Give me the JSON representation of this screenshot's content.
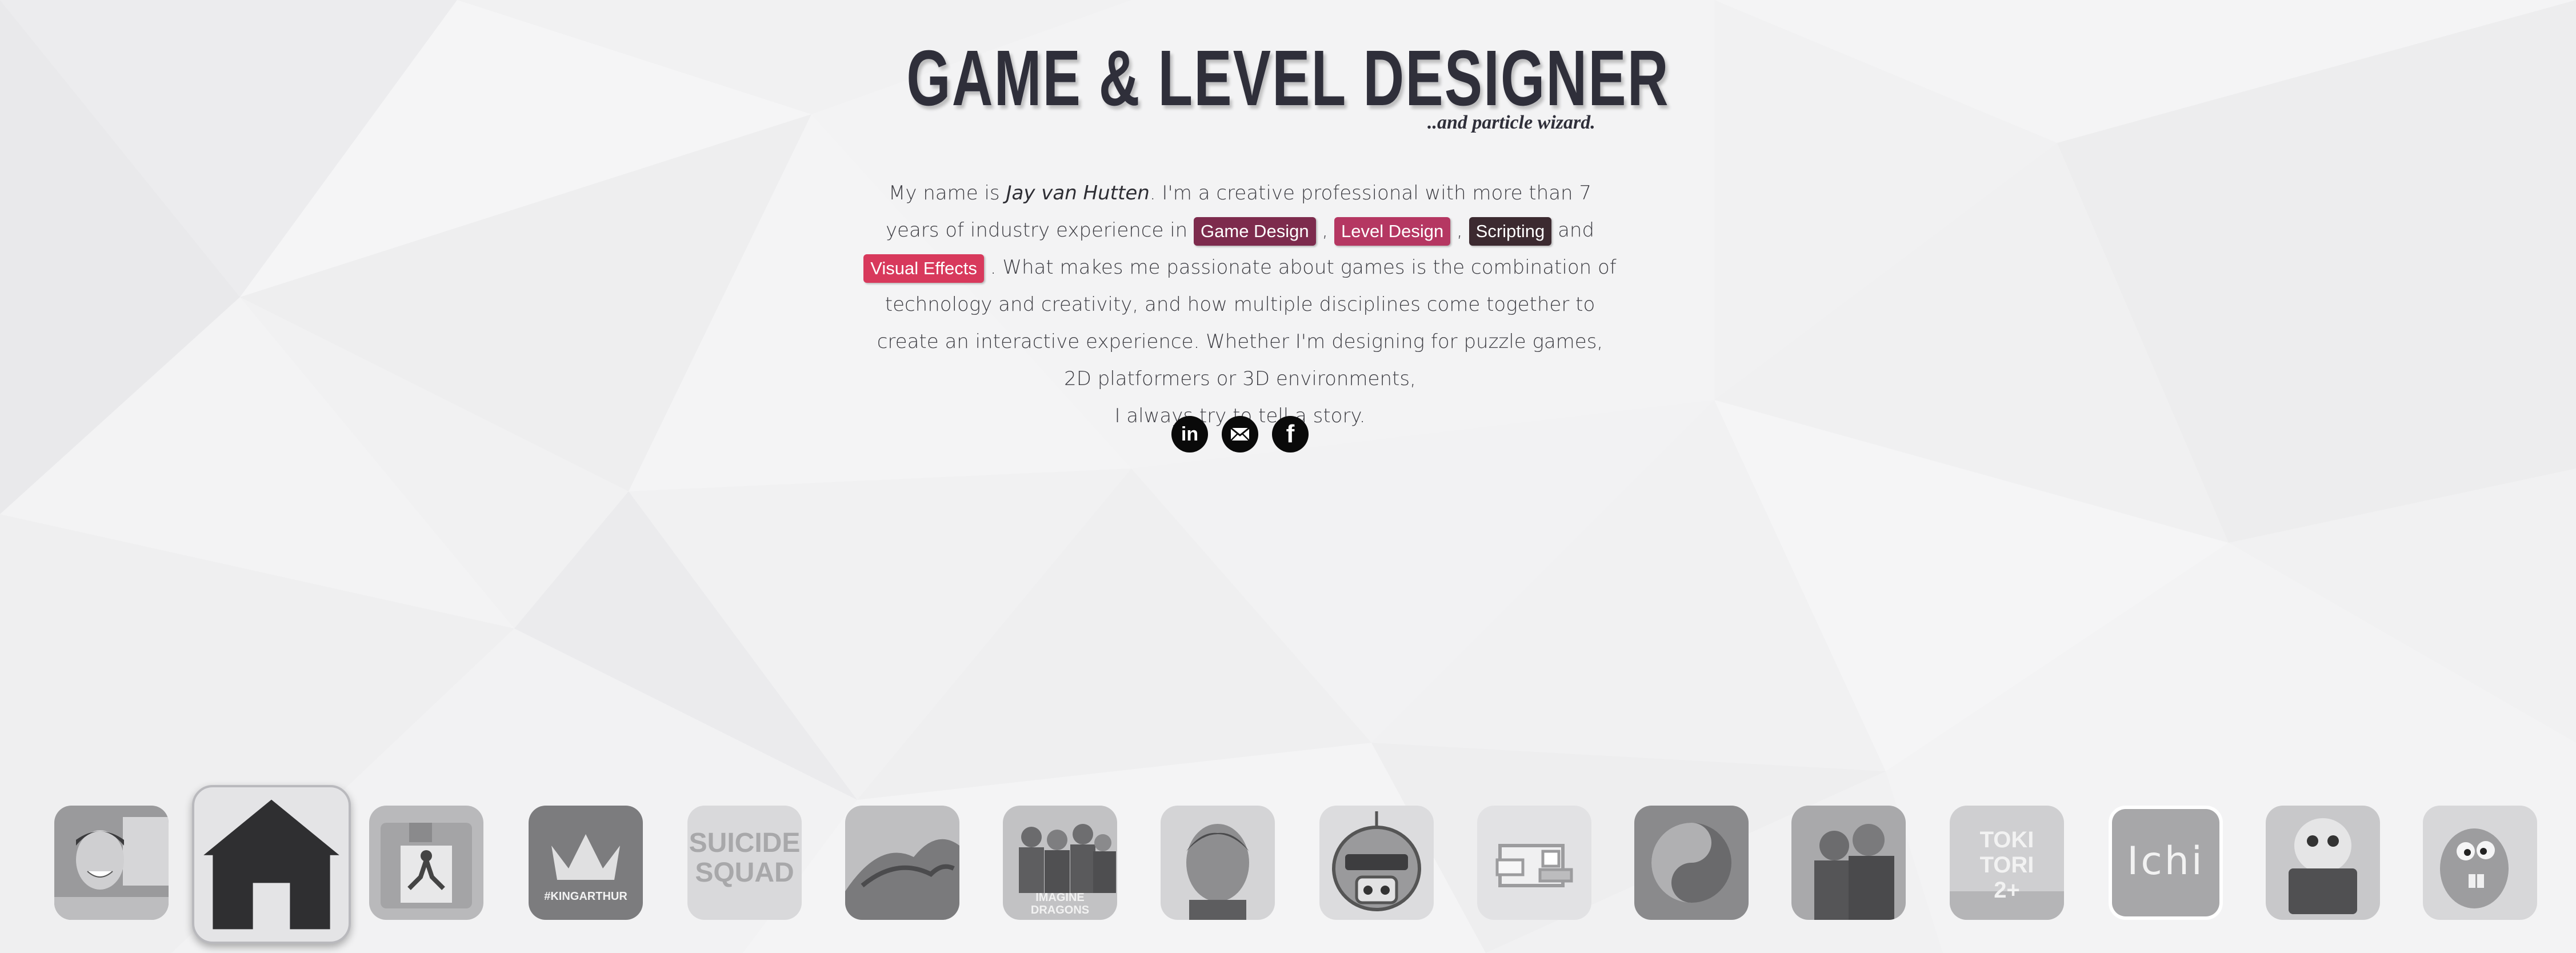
{
  "header": {
    "title": "GAME & LEVEL DESIGNER",
    "subtitle": "..and particle wizard."
  },
  "bio": {
    "p1": "My name is ",
    "name": "Jay van Hutten",
    "p2": ". I'm a creative professional with more than 7 years of industry experience in ",
    "tags": [
      {
        "label": "Game Design",
        "color": "#7d2b4d"
      },
      {
        "label": "Level Design",
        "color": "#b53762"
      },
      {
        "label": "Scripting",
        "color": "#3c2a30"
      },
      {
        "label": "Visual Effects",
        "color": "#d8395c"
      }
    ],
    "sep1": " , ",
    "sep2": " , ",
    "sep3": "  and ",
    "p3": " . What makes me passionate about games is the combination of technology and creativity, and how multiple disciplines come together to create an interactive experience. Whether I'm designing for puzzle games, 2D platformers or 3D environments,",
    "p4": "I always try to tell a story."
  },
  "social": [
    {
      "name": "linkedin",
      "glyph": "in"
    },
    {
      "name": "email",
      "glyph": "✉"
    },
    {
      "name": "facebook",
      "glyph": "f"
    }
  ],
  "dock": {
    "items": [
      {
        "name": "profile-photo"
      },
      {
        "name": "home",
        "icon": "home-icon"
      },
      {
        "name": "exit-game"
      },
      {
        "name": "king-arthur",
        "text": "#KINGARTHUR"
      },
      {
        "name": "suicide-squad",
        "text": "SUICIDE SQUAD"
      },
      {
        "name": "dragon"
      },
      {
        "name": "imagine-dragons",
        "text": "IMAGINE DRAGONS"
      },
      {
        "name": "maze-runner"
      },
      {
        "name": "robot-character"
      },
      {
        "name": "flappy-bird"
      },
      {
        "name": "yin-yang"
      },
      {
        "name": "soldiers"
      },
      {
        "name": "toki-tori",
        "text": "TOKI TORI 2+"
      },
      {
        "name": "ichi",
        "text": "Ichi"
      },
      {
        "name": "mascot"
      },
      {
        "name": "ice-age"
      }
    ]
  },
  "colors": {
    "accent": "#b53762",
    "title": "#2f2f3a"
  }
}
